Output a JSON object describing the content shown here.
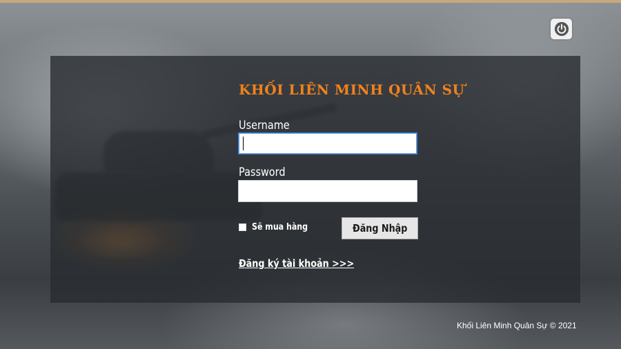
{
  "app": {
    "title": "KHỐI LIÊN MINH QUÂN SỰ",
    "accent_color": "#f0821e"
  },
  "power_button": {
    "icon": "power-icon"
  },
  "login_form": {
    "username_label": "Username",
    "username_value": "",
    "password_label": "Password",
    "password_value": "",
    "remember_label": "Sẽ mua hàng",
    "remember_checked": false,
    "login_button_label": "Đăng Nhập",
    "register_link_label": "Đăng ký tài khoản >>>"
  },
  "footer": {
    "copyright": "Khối Liên Minh Quân Sự © 2021"
  }
}
